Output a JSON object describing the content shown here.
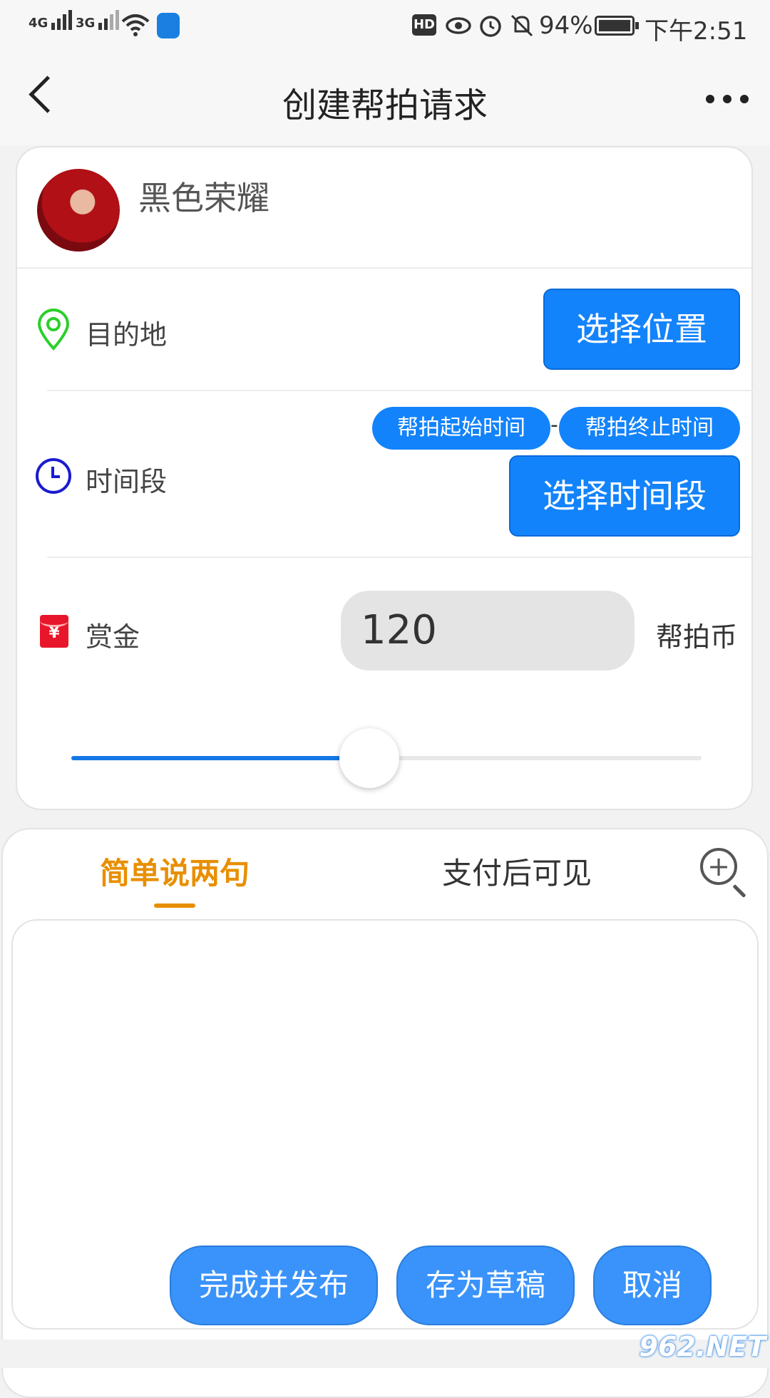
{
  "status_bar": {
    "net1": "4G",
    "net2": "3G",
    "wifi_tag": "4",
    "battery": "94%",
    "time": "下午2:51",
    "hd": "HD"
  },
  "nav": {
    "title": "创建帮拍请求"
  },
  "profile": {
    "username": "黑色荣耀"
  },
  "destination": {
    "label": "目的地",
    "button": "选择位置"
  },
  "time_range": {
    "label": "时间段",
    "start": "帮拍起始时间",
    "separator": "-",
    "end": "帮拍终止时间",
    "button": "选择时间段"
  },
  "reward": {
    "label": "赏金",
    "icon_text": "¥",
    "amount": "120",
    "unit": "帮拍币",
    "slider_fraction": 0.5
  },
  "tabs": {
    "items": [
      "简单说两句",
      "支付后可见"
    ],
    "active": 0
  },
  "actions": {
    "publish": "完成并发布",
    "draft": "存为草稿",
    "cancel": "取消"
  },
  "watermark": "962.NET",
  "colors": {
    "primary": "#1383fb",
    "accent_tab": "#e88f00",
    "location_icon": "#2bcf2b",
    "clock_icon": "#1a1ad0",
    "redpacket": "#e8162b"
  }
}
